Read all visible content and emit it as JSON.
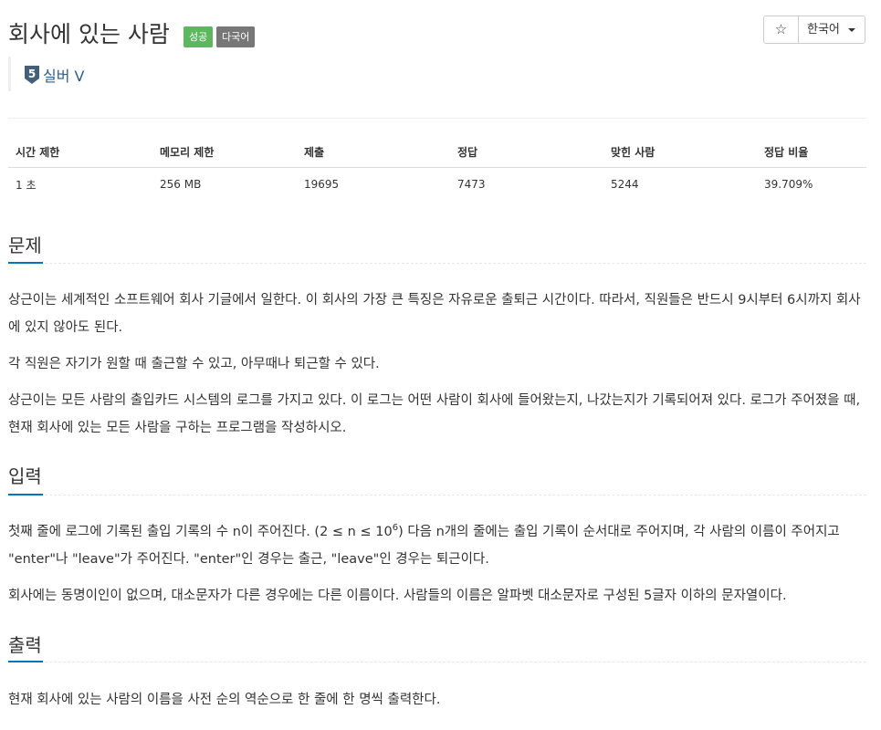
{
  "problem": {
    "title": "회사에 있는 사람",
    "labels": {
      "status": "성공",
      "multilang": "다국어"
    },
    "star_icon": "☆",
    "language": "한국어",
    "tier": {
      "label": "실버 V",
      "number": "5"
    }
  },
  "info_table": {
    "headers": [
      "시간 제한",
      "메모리 제한",
      "제출",
      "정답",
      "맞힌 사람",
      "정답 비율"
    ],
    "values": [
      "1 초",
      "256 MB",
      "19695",
      "7473",
      "5244",
      "39.709%"
    ]
  },
  "sections": {
    "problem_title": "문제",
    "problem_p1": "상근이는 세계적인 소프트웨어 회사 기글에서 일한다. 이 회사의 가장 큰 특징은 자유로운 출퇴근 시간이다. 따라서, 직원들은 반드시 9시부터 6시까지 회사에 있지 않아도 된다.",
    "problem_p2": "각 직원은 자기가 원할 때 출근할 수 있고, 아무때나 퇴근할 수 있다.",
    "problem_p3": "상근이는 모든 사람의 출입카드 시스템의 로그를 가지고 있다. 이 로그는 어떤 사람이 회사에 들어왔는지, 나갔는지가 기록되어져 있다. 로그가 주어졌을 때, 현재 회사에 있는 모든 사람을 구하는 프로그램을 작성하시오.",
    "input_title": "입력",
    "input_p1_a": "첫째 줄에 로그에 기록된 출입 기록의 수 n이 주어진다. (2 ≤ n ≤ 10",
    "input_p1_sup": "6",
    "input_p1_b": ") 다음 n개의 줄에는 출입 기록이 순서대로 주어지며, 각 사람의 이름이 주어지고 \"enter\"나 \"leave\"가 주어진다. \"enter\"인 경우는 출근, \"leave\"인 경우는 퇴근이다.",
    "input_p2": "회사에는 동명이인이 없으며, 대소문자가 다른 경우에는 다른 이름이다. 사람들의 이름은 알파벳 대소문자로 구성된 5글자 이하의 문자열이다.",
    "output_title": "출력",
    "output_p1": "현재 회사에 있는 사람의 이름을 사전 순의 역순으로 한 줄에 한 명씩 출력한다."
  },
  "colors": {
    "success": "#5cb85c",
    "default": "#777777",
    "accent": "#0076c0",
    "tier": "#2d5d8a"
  }
}
